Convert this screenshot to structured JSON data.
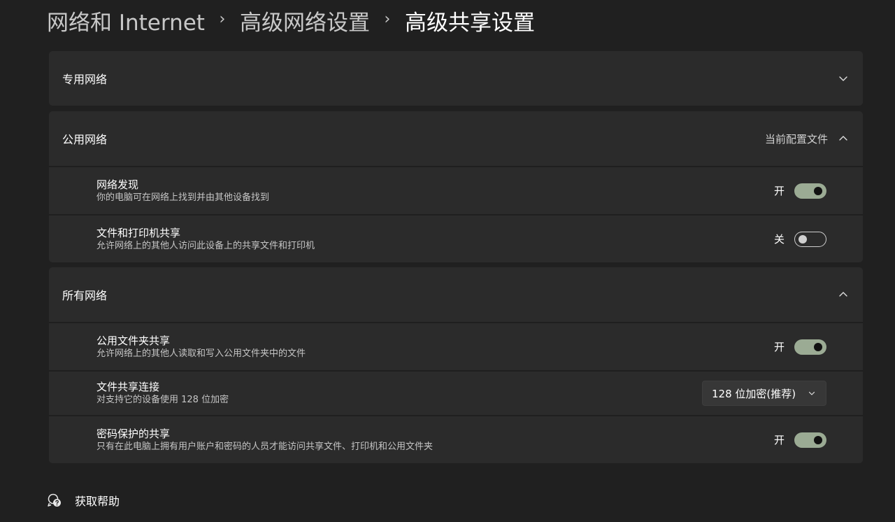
{
  "breadcrumb": {
    "items": [
      "网络和 Internet",
      "高级网络设置",
      "高级共享设置"
    ],
    "separator": "›"
  },
  "sections": {
    "private": {
      "title": "专用网络",
      "expanded": false
    },
    "public": {
      "title": "公用网络",
      "meta": "当前配置文件",
      "expanded": true,
      "rows": [
        {
          "title": "网络发现",
          "subtitle": "你的电脑可在网络上找到并由其他设备找到",
          "state_label": "开",
          "on": true
        },
        {
          "title": "文件和打印机共享",
          "subtitle": "允许网络上的其他人访问此设备上的共享文件和打印机",
          "state_label": "关",
          "on": false
        }
      ]
    },
    "all": {
      "title": "所有网络",
      "expanded": true,
      "rows": [
        {
          "title": "公用文件夹共享",
          "subtitle": "允许网络上的其他人读取和写入公用文件夹中的文件",
          "state_label": "开",
          "on": true
        },
        {
          "title": "文件共享连接",
          "subtitle": "对支持它的设备使用 128 位加密",
          "dropdown_value": "128 位加密(推荐)"
        },
        {
          "title": "密码保护的共享",
          "subtitle": "只有在此电脑上拥有用户账户和密码的人员才能访问共享文件、打印机和公用文件夹",
          "state_label": "开",
          "on": true
        }
      ]
    }
  },
  "help": {
    "label": "获取帮助",
    "icon": "help-chat-icon"
  },
  "colors": {
    "background": "#202020",
    "card": "#2b2b2b",
    "toggle_on": "#9bab94",
    "text": "#ffffff",
    "secondary_text": "#c5c5c5"
  }
}
